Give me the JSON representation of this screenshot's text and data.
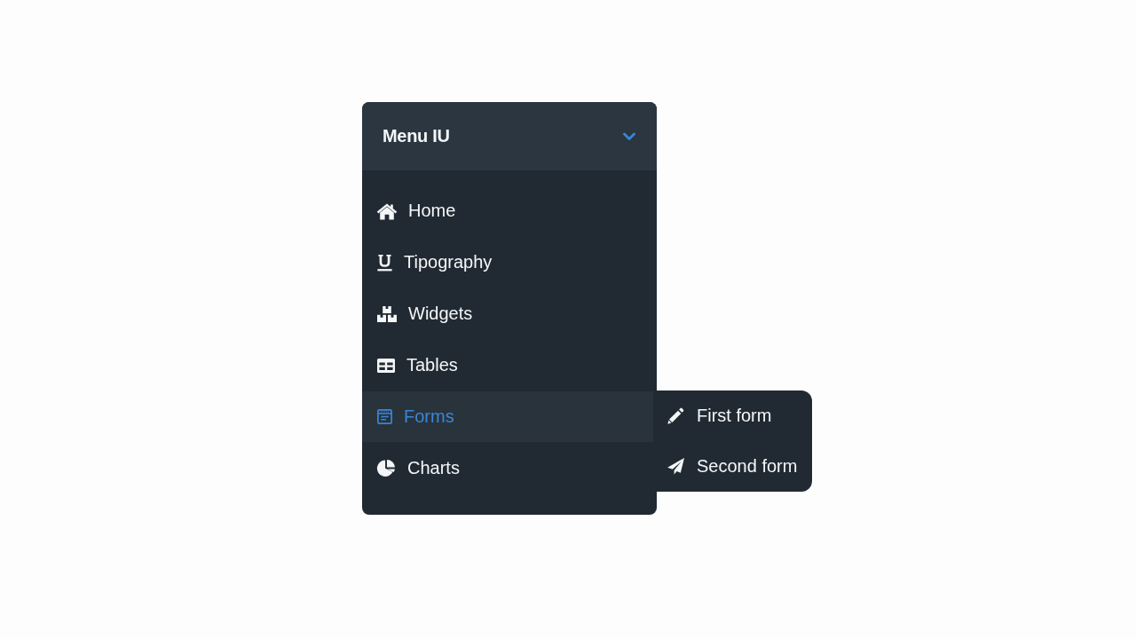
{
  "menu": {
    "title": "Menu IU",
    "expanded": true,
    "items": [
      {
        "label": "Home",
        "selected": false
      },
      {
        "label": "Tipography",
        "selected": false
      },
      {
        "label": "Widgets",
        "selected": false
      },
      {
        "label": "Tables",
        "selected": false
      },
      {
        "label": "Forms",
        "selected": true,
        "submenu": [
          {
            "label": "First form"
          },
          {
            "label": "Second form"
          }
        ]
      },
      {
        "label": "Charts",
        "selected": false
      }
    ]
  }
}
